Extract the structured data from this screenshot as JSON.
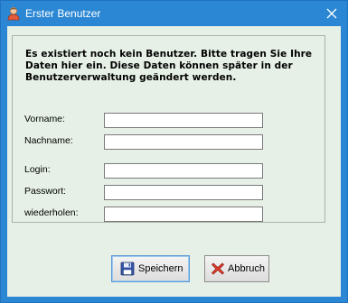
{
  "window": {
    "title": "Erster Benutzer",
    "close_glyph": "✕",
    "app_icon": "user-icon",
    "titlebar_color": "#2b87d3",
    "client_color": "#e6f0e6"
  },
  "intro_text": "Es existiert noch kein Benutzer. Bitte tragen Sie Ihre Daten hier ein. Diese Daten können später in der Benutzerverwaltung geändert werden.",
  "form": {
    "fields": [
      {
        "label": "Vorname:",
        "value": ""
      },
      {
        "label": "Nachname:",
        "value": ""
      },
      {
        "label": "Login:",
        "value": ""
      },
      {
        "label": "Passwort:",
        "value": ""
      },
      {
        "label": "wiederholen:",
        "value": ""
      }
    ]
  },
  "buttons": {
    "save": {
      "label": "Speichern",
      "icon": "floppy-disk-icon"
    },
    "cancel": {
      "label": "Abbruch",
      "icon": "red-x-icon"
    }
  }
}
